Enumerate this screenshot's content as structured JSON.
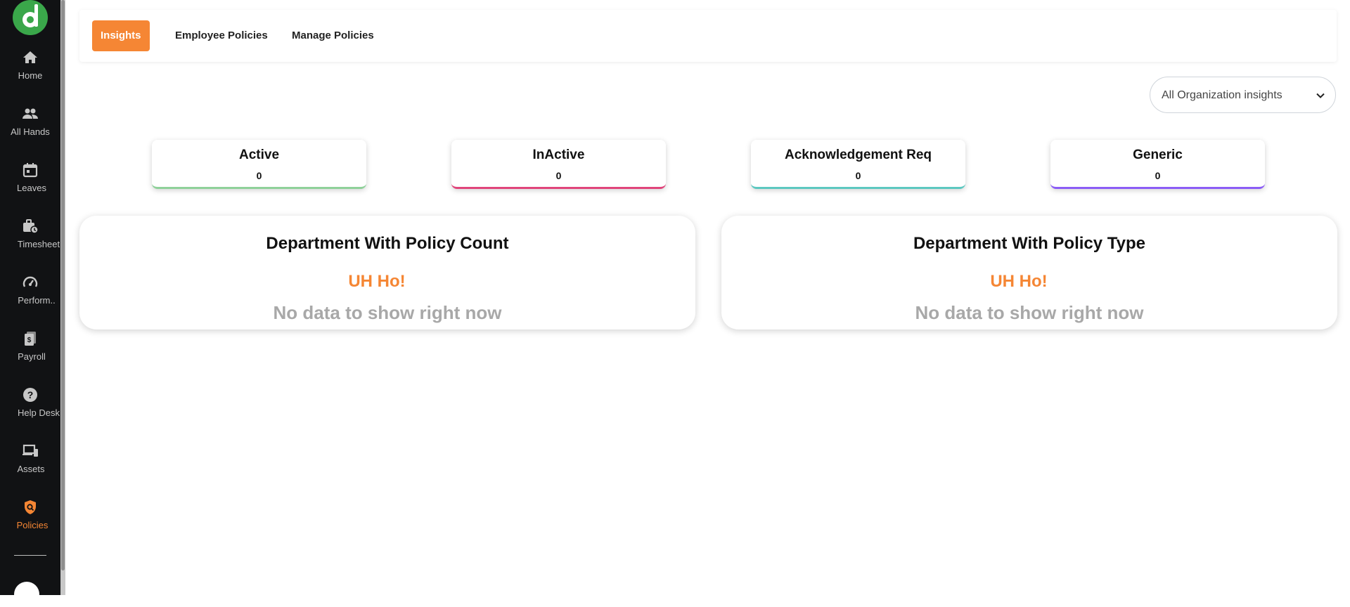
{
  "sidebar": {
    "items": [
      {
        "label": "Home",
        "icon": "home-icon"
      },
      {
        "label": "All Hands",
        "icon": "people-icon"
      },
      {
        "label": "Leaves",
        "icon": "calendar-icon"
      },
      {
        "label": "Timesheet",
        "icon": "briefcase-clock-icon"
      },
      {
        "label": "Perform..",
        "icon": "speedometer-icon"
      },
      {
        "label": "Payroll",
        "icon": "payroll-icon"
      },
      {
        "label": "Help Desk",
        "icon": "help-icon"
      },
      {
        "label": "Assets",
        "icon": "devices-icon"
      },
      {
        "label": "Policies",
        "icon": "policy-shield-icon"
      }
    ]
  },
  "tabs": [
    {
      "label": "Insights",
      "active": true
    },
    {
      "label": "Employee Policies",
      "active": false
    },
    {
      "label": "Manage Policies",
      "active": false
    }
  ],
  "filter": {
    "selected": "All Organization insights"
  },
  "stats": [
    {
      "title": "Active",
      "value": "0",
      "color": "#8fd19a"
    },
    {
      "title": "InActive",
      "value": "0",
      "color": "#e0457b"
    },
    {
      "title": "Acknowledgement Req",
      "value": "0",
      "color": "#5cc8c0"
    },
    {
      "title": "Generic",
      "value": "0",
      "color": "#8b5cf6"
    }
  ],
  "panels": [
    {
      "title": "Department With Policy Count",
      "uh": "UH Ho!",
      "empty": "No data to show right now"
    },
    {
      "title": "Department With Policy Type",
      "uh": "UH Ho!",
      "empty": "No data to show right now"
    }
  ],
  "colors": {
    "accent": "#f58634",
    "sidebar_bg": "#111214",
    "brand": "#3aa74a"
  }
}
